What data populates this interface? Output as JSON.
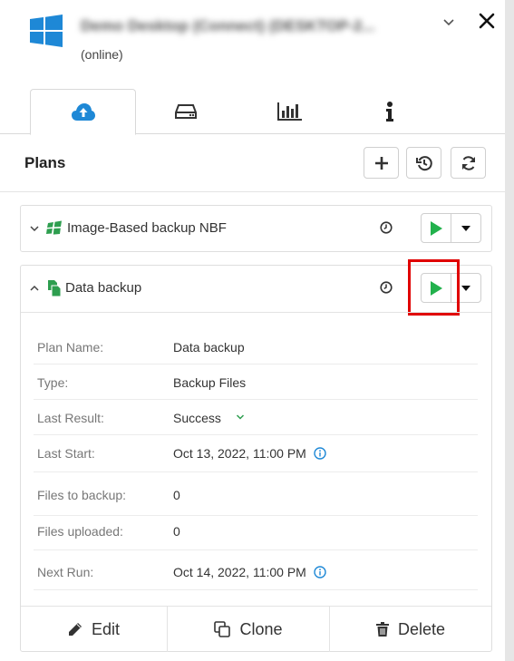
{
  "header": {
    "computer_name": "Demo Desktop (Connect) (DESKTOP-2...",
    "status": "(online)",
    "icons": {
      "logo": "windows-logo-icon",
      "expand": "chevron-down-icon",
      "close": "close-icon"
    }
  },
  "tabs": [
    {
      "name": "plans-tab",
      "icon": "cloud-upload-icon",
      "active": true
    },
    {
      "name": "storage-tab",
      "icon": "hard-drive-icon",
      "active": false
    },
    {
      "name": "reports-tab",
      "icon": "bar-chart-icon",
      "active": false
    },
    {
      "name": "info-tab",
      "icon": "info-icon",
      "active": false
    }
  ],
  "plans": {
    "title": "Plans",
    "toolbar": [
      {
        "name": "add-plan-button",
        "icon": "plus-icon"
      },
      {
        "name": "history-button",
        "icon": "history-icon"
      },
      {
        "name": "refresh-button",
        "icon": "refresh-icon"
      }
    ],
    "items": [
      {
        "name": "Image-Based backup NBF",
        "expanded": false,
        "icon": "windows-image-icon"
      },
      {
        "name": "Data backup",
        "expanded": true,
        "icon": "file-backup-icon",
        "details": [
          {
            "label": "Plan Name:",
            "value": "Data backup"
          },
          {
            "label": "Type:",
            "value": "Backup Files"
          },
          {
            "label": "Last Result:",
            "value": "Success"
          },
          {
            "label": "Last Start:",
            "value": "Oct 13, 2022, 11:00 PM"
          },
          {
            "label": "Files to backup:",
            "value": "0"
          },
          {
            "label": "Files uploaded:",
            "value": "0"
          },
          {
            "label": "Next Run:",
            "value": "Oct 14, 2022, 11:00 PM"
          }
        ],
        "actions": {
          "edit": "Edit",
          "clone": "Clone",
          "delete": "Delete"
        }
      }
    ]
  },
  "colors": {
    "accent": "#1e88d6",
    "play": "#22b14c",
    "success": "#2e9e4f",
    "highlight": "#e00000"
  }
}
